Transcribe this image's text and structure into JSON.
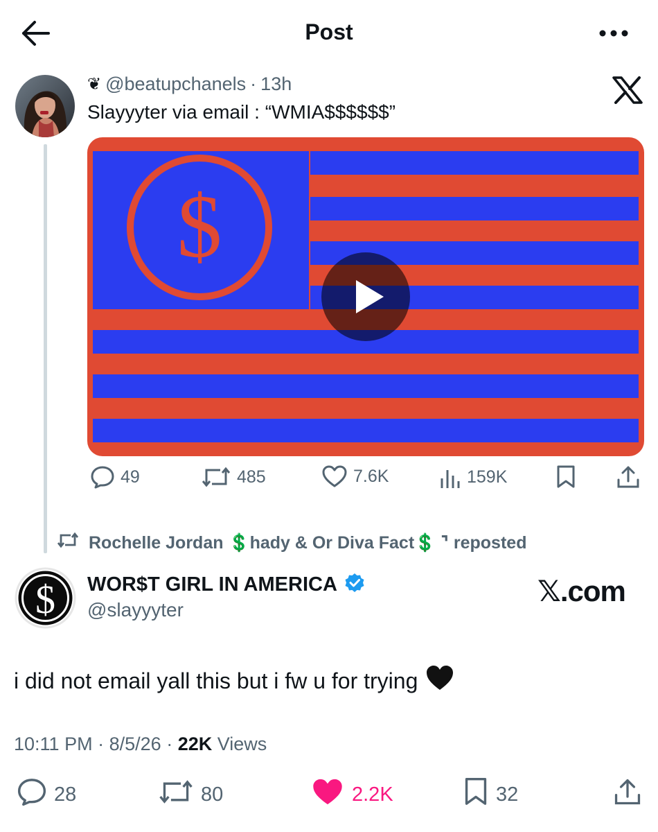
{
  "header": {
    "title": "Post"
  },
  "quoted_post": {
    "emoji": "❦",
    "handle": "@beatupchanels",
    "separator": "·",
    "time": "13h",
    "text": "Slayyyter via email : “WMIA$$$$$$”",
    "media": {
      "type": "video",
      "description_colors": {
        "stripe_red": "#e04a33",
        "stripe_blue": "#2b3df0"
      }
    },
    "stats": {
      "replies": "49",
      "reposts": "485",
      "likes": "7.6K",
      "views": "159K"
    }
  },
  "repost_banner": {
    "text": "Rochelle Jordan 💲hady & Or Diva Fact💲 ⌝ reposted"
  },
  "main_post": {
    "display_name": "WOR$T GIRL IN AMERICA",
    "verified": true,
    "handle": "@slayyyter",
    "watermark": "𝕏.com",
    "text": "i did not email yall this but i fw u for trying",
    "emoji": "🖤",
    "timestamp": "10:11 PM",
    "date": "8/5/26",
    "separator": "·",
    "views_count": "22K",
    "views_label": "Views",
    "stats": {
      "replies": "28",
      "reposts": "80",
      "likes": "2.2K",
      "bookmarks": "32"
    }
  },
  "colors": {
    "text_primary": "#0f1419",
    "text_secondary": "#536471",
    "like_pink": "#f91880",
    "verified_blue": "#1d9bf0"
  }
}
